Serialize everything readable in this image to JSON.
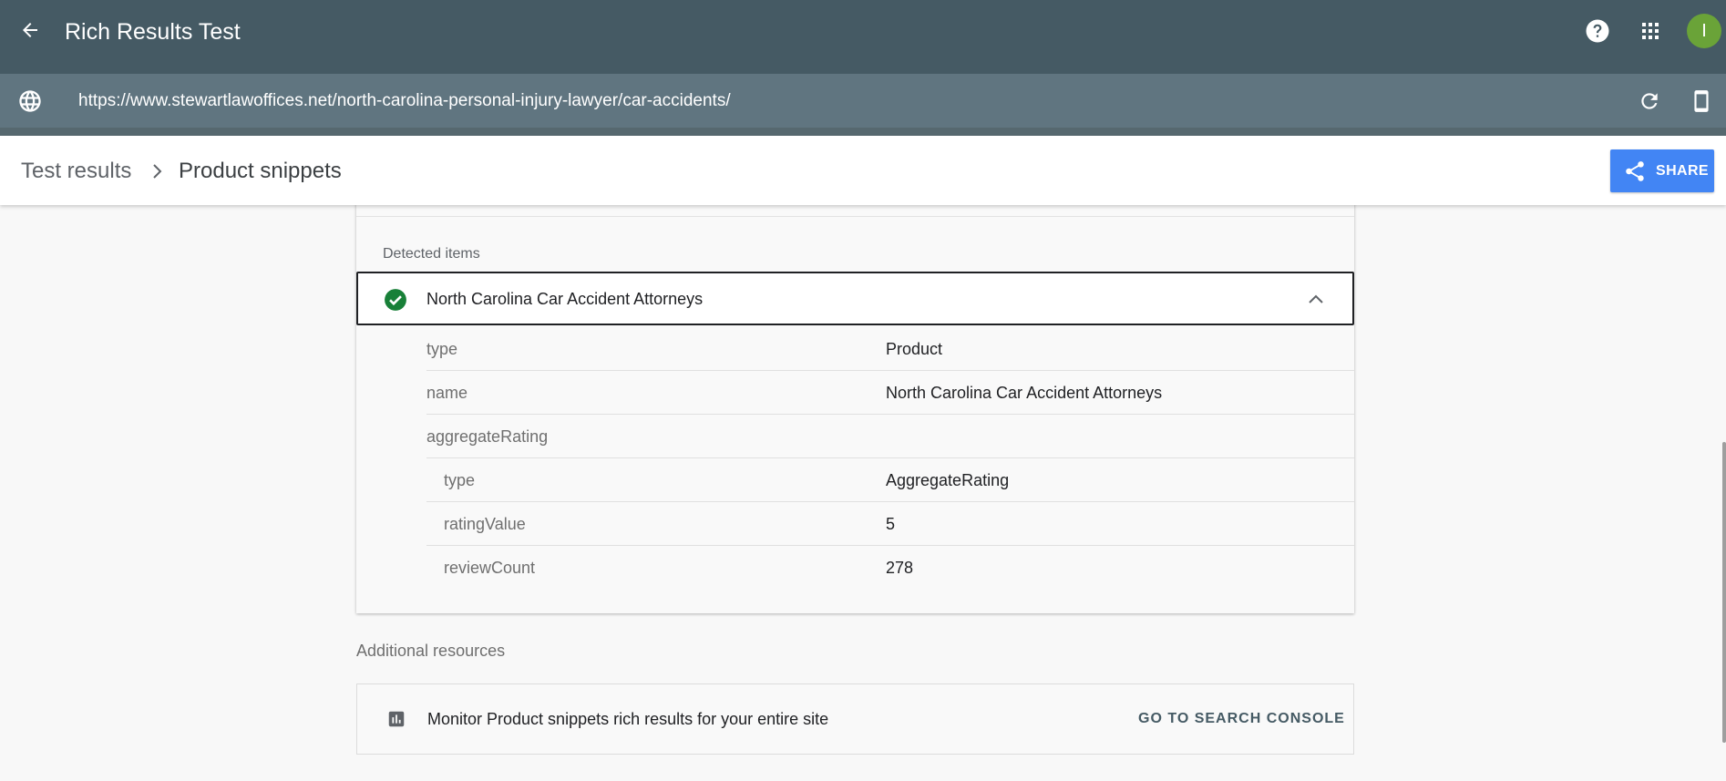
{
  "header": {
    "title": "Rich Results Test",
    "back_icon": "arrow-left-icon",
    "help_icon": "help-circle-icon",
    "apps_icon": "apps-grid-icon",
    "avatar_letter": "I",
    "avatar_color": "#6aa338",
    "bar_color": "#455a64"
  },
  "urlbar": {
    "url": "https://www.stewartlawoffices.net/north-carolina-personal-injury-lawyer/car-accidents/",
    "globe_icon": "globe-icon",
    "reload_icon": "reload-icon",
    "device_icon": "smartphone-icon"
  },
  "breadcrumb": {
    "parent": "Test results",
    "current": "Product snippets",
    "separator_icon": "chevron-right-icon"
  },
  "share": {
    "label": "SHARE",
    "icon": "share-icon",
    "color": "#4285f4"
  },
  "detected": {
    "section_label": "Detected items",
    "item": {
      "title": "North Carolina Car Accident Attorneys",
      "status_icon": "check-circle-icon",
      "status_color": "#188038",
      "expanded": true,
      "properties": [
        {
          "key": "type",
          "value": "Product",
          "indent": 0
        },
        {
          "key": "name",
          "value": "North Carolina Car Accident Attorneys",
          "indent": 0
        },
        {
          "key": "aggregateRating",
          "value": "",
          "indent": 0
        },
        {
          "key": "type",
          "value": "AggregateRating",
          "indent": 1
        },
        {
          "key": "ratingValue",
          "value": "5",
          "indent": 1
        },
        {
          "key": "reviewCount",
          "value": "278",
          "indent": 1
        }
      ]
    }
  },
  "additional": {
    "section_label": "Additional resources",
    "resource_text": "Monitor Product snippets rich results for your entire site",
    "resource_icon": "bar-chart-icon",
    "link_label": "GO TO SEARCH CONSOLE"
  }
}
